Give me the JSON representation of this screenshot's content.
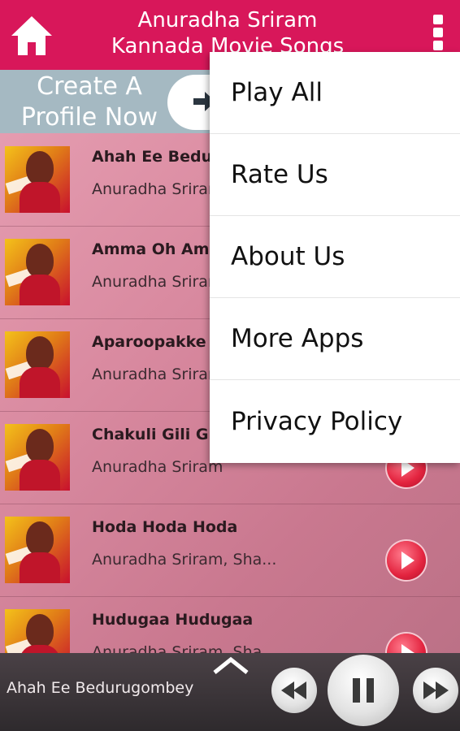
{
  "header": {
    "title_line1": "Anuradha Sriram",
    "title_line2": "Kannada Movie Songs",
    "background_color": "#d8175a",
    "home_icon": "home-icon",
    "overflow_icon": "overflow-menu-icon"
  },
  "banner": {
    "line1": "Create A",
    "line2": "Profile Now",
    "arrow_icon": "arrow-right-icon"
  },
  "songs": [
    {
      "title": "Ahah Ee Bedurugombey",
      "artist": "Anuradha Sriram"
    },
    {
      "title": "Amma Oh Amma",
      "artist": "Anuradha Sriram"
    },
    {
      "title": "Aparoopakke",
      "artist": "Anuradha Sriram"
    },
    {
      "title": "Chakuli Gili Gili",
      "artist": "Anuradha Sriram"
    },
    {
      "title": "Hoda Hoda Hoda",
      "artist": "Anuradha Sriram, Sha..."
    },
    {
      "title": "Hudugaa Hudugaa",
      "artist": "Anuradha Sriram, Sha..."
    }
  ],
  "player": {
    "now_playing": "Ahah Ee Bedurugombey",
    "expand_icon": "chevron-up-icon",
    "rewind_icon": "rewind-icon",
    "pause_icon": "pause-icon",
    "forward_icon": "fast-forward-icon"
  },
  "menu": {
    "items": [
      "Play All",
      "Rate Us",
      "About Us",
      "More Apps",
      "Privacy Policy"
    ]
  }
}
